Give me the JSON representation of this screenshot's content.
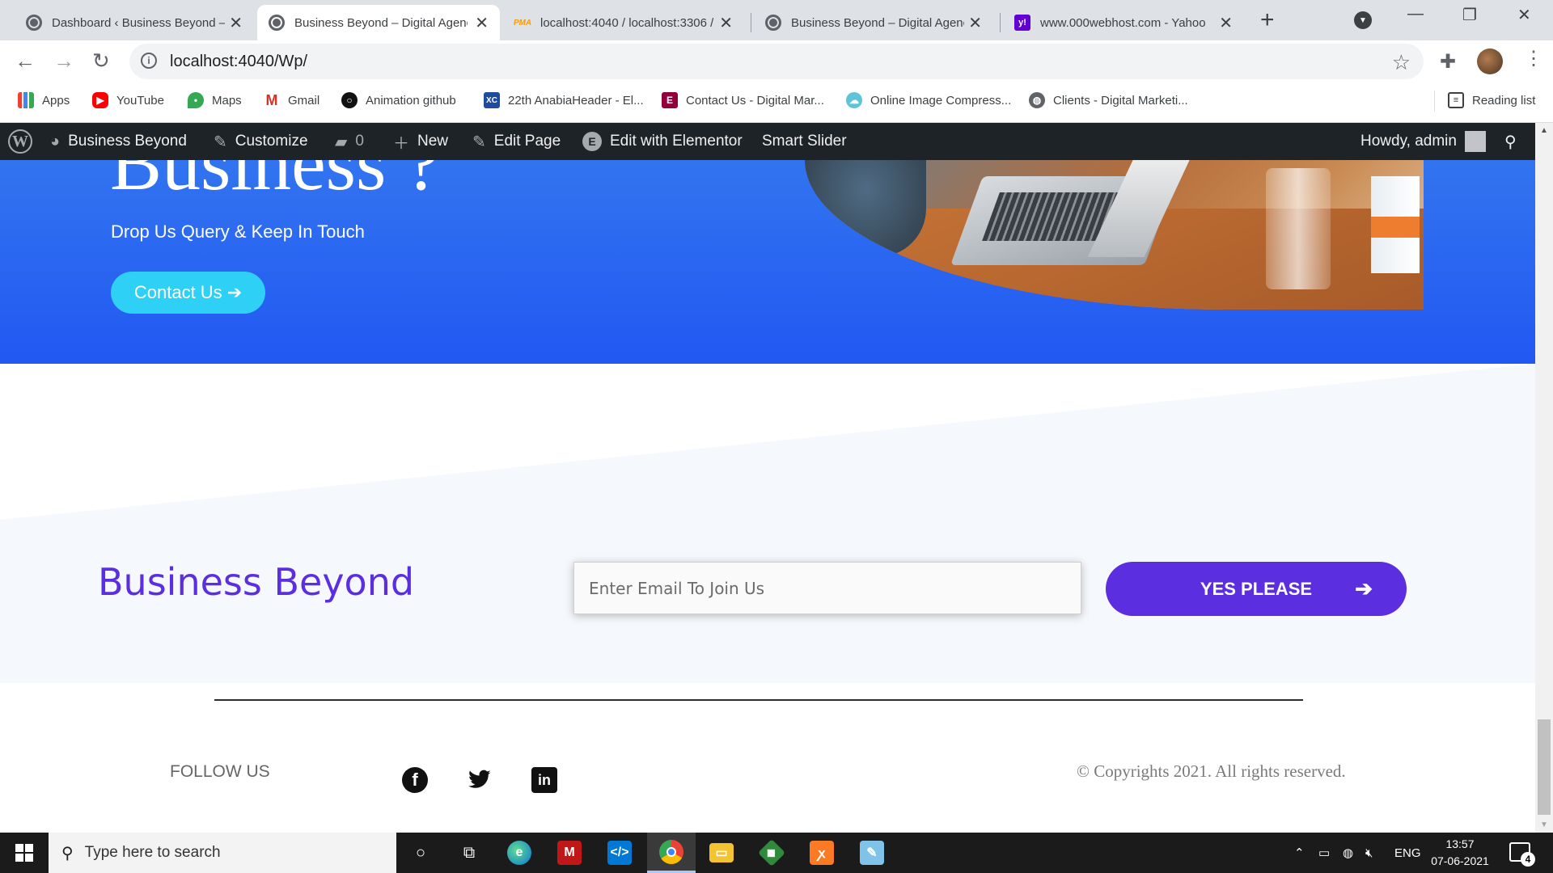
{
  "browser": {
    "tabs": [
      {
        "title": "Dashboard ‹ Business Beyond —",
        "icon": "globe-icon",
        "active": false
      },
      {
        "title": "Business Beyond – Digital Agenc",
        "icon": "globe-icon",
        "active": true
      },
      {
        "title": "localhost:4040 / localhost:3306 /",
        "icon": "phpmyadmin-icon",
        "active": false
      },
      {
        "title": "Business Beyond – Digital Agenc",
        "icon": "globe-icon",
        "active": false
      },
      {
        "title": "www.000webhost.com - Yahoo",
        "icon": "yahoo-icon",
        "active": false
      }
    ],
    "url": "localhost:4040/Wp/",
    "bookmarks": [
      {
        "label": "Apps",
        "icon": "apps-grid-icon"
      },
      {
        "label": "YouTube",
        "icon": "youtube-icon"
      },
      {
        "label": "Maps",
        "icon": "maps-icon"
      },
      {
        "label": "Gmail",
        "icon": "gmail-icon"
      },
      {
        "label": "Animation github",
        "icon": "github-icon"
      },
      {
        "label": "22th AnabiaHeader - El...",
        "icon": "site-icon"
      },
      {
        "label": "Contact Us - Digital Mar...",
        "icon": "elementor-icon"
      },
      {
        "label": "Online Image Compress...",
        "icon": "cloud-icon"
      },
      {
        "label": "Clients - Digital Marketi...",
        "icon": "globe-icon"
      }
    ],
    "reading_list": "Reading list"
  },
  "adminbar": {
    "site_name": "Business Beyond",
    "customize": "Customize",
    "comments_count": "0",
    "new": "New",
    "edit_page": "Edit Page",
    "edit_elementor": "Edit with Elementor",
    "smart_slider": "Smart Slider",
    "howdy": "Howdy, admin"
  },
  "hero": {
    "title_fragment": "Business ?",
    "subtitle": "Drop Us Query & Keep In Touch",
    "button": "Contact Us"
  },
  "subscribe": {
    "brand": "Business Beyond",
    "email_placeholder": "Enter Email To Join Us",
    "button": "YES PLEASE"
  },
  "footer": {
    "follow": "FOLLOW US",
    "social": [
      "facebook-icon",
      "twitter-icon",
      "linkedin-icon"
    ],
    "copyright": "© Copyrights 2021. All rights reserved."
  },
  "taskbar": {
    "search_placeholder": "Type here to search",
    "language": "ENG",
    "time": "13:57",
    "date": "07-06-2021",
    "notifications": "4"
  },
  "colors": {
    "hero_blue": "#2a62f0",
    "contact_btn": "#2fd0f5",
    "brand_purple": "#5b2fe0",
    "adminbar": "#1d2327"
  }
}
